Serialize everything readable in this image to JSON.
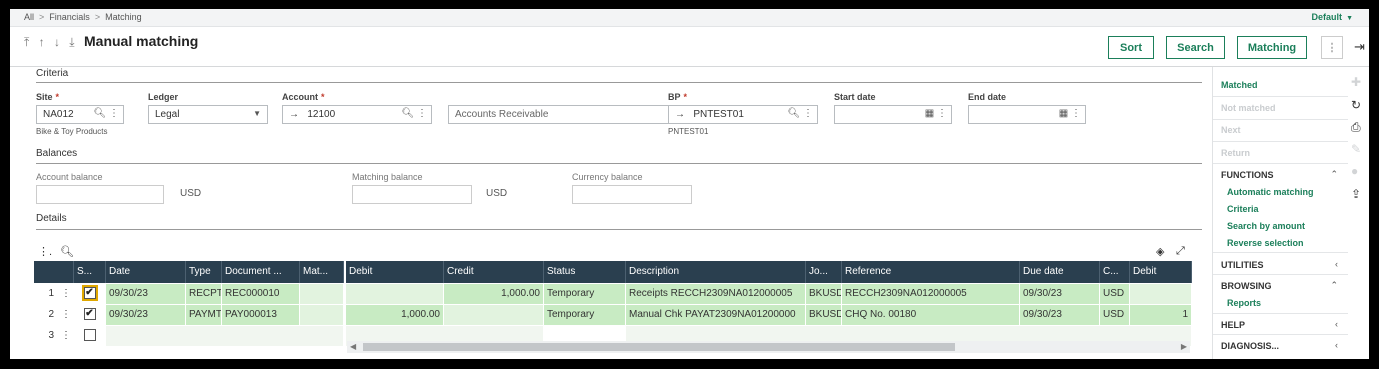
{
  "breadcrumb": [
    "All",
    "Financials",
    "Matching"
  ],
  "default_label": "Default",
  "page_title": "Manual matching",
  "nav_arrows": "⤒ ↑ ↓ ⤓",
  "buttons": {
    "sort": "Sort",
    "search": "Search",
    "matching": "Matching",
    "more": "⋮"
  },
  "criteria": {
    "title": "Criteria",
    "site": {
      "label": "Site",
      "value": "NA012",
      "sub": "Bike & Toy Products"
    },
    "ledger": {
      "label": "Ledger",
      "value": "Legal"
    },
    "account": {
      "label": "Account",
      "value": "12100",
      "desc": "Accounts Receivable"
    },
    "bp": {
      "label": "BP",
      "value": "PNTEST01",
      "sub": "PNTEST01"
    },
    "start_date": {
      "label": "Start date",
      "value": ""
    },
    "end_date": {
      "label": "End date",
      "value": ""
    }
  },
  "balances": {
    "title": "Balances",
    "account_balance": {
      "label": "Account balance",
      "value": "",
      "currency": "USD"
    },
    "matching_balance": {
      "label": "Matching balance",
      "value": "",
      "currency": "USD"
    },
    "currency_balance": {
      "label": "Currency balance",
      "value": ""
    }
  },
  "details": {
    "title": "Details",
    "columns": [
      "S...",
      "Date",
      "Type",
      "Document ...",
      "Mat...",
      "Debit",
      "Credit",
      "Status",
      "Description",
      "Jo...",
      "Reference",
      "Due date",
      "C...",
      "Debit"
    ],
    "rows": [
      {
        "num": "1",
        "checked": true,
        "date": "09/30/23",
        "type": "RECPT",
        "document": "REC000010",
        "mat": "",
        "debit": "",
        "credit": "1,000.00",
        "status": "Temporary",
        "description": "Receipts RECCH2309NA012000005",
        "journal": "BKUSD",
        "reference": "RECCH2309NA012000005",
        "due_date": "09/30/23",
        "currency": "USD",
        "debit2": ""
      },
      {
        "num": "2",
        "checked": true,
        "date": "09/30/23",
        "type": "PAYMT",
        "document": "PAY000013",
        "mat": "",
        "debit": "1,000.00",
        "credit": "",
        "status": "Temporary",
        "description": "Manual Chk PAYAT2309NA01200000",
        "journal": "BKUSD",
        "reference": "CHQ No. 00180",
        "due_date": "09/30/23",
        "currency": "USD",
        "debit2": "1"
      },
      {
        "num": "3",
        "checked": false
      }
    ]
  },
  "side_panel": {
    "actions": [
      {
        "label": "Matched",
        "enabled": true
      },
      {
        "label": "Not matched",
        "enabled": false
      },
      {
        "label": "Next",
        "enabled": false
      },
      {
        "label": "Return",
        "enabled": false
      }
    ],
    "functions": {
      "title": "FUNCTIONS",
      "items": [
        "Automatic matching",
        "Criteria",
        "Search by amount",
        "Reverse selection"
      ]
    },
    "utilities": {
      "title": "UTILITIES"
    },
    "browsing": {
      "title": "BROWSING",
      "items": [
        "Reports"
      ]
    },
    "help": {
      "title": "HELP"
    },
    "diagnosis": {
      "title": "DIAGNOSIS..."
    }
  },
  "colors": {
    "accent": "#1b7f5a",
    "grid_header": "#2a3f4f",
    "row_highlight": "#c8ebc3"
  }
}
